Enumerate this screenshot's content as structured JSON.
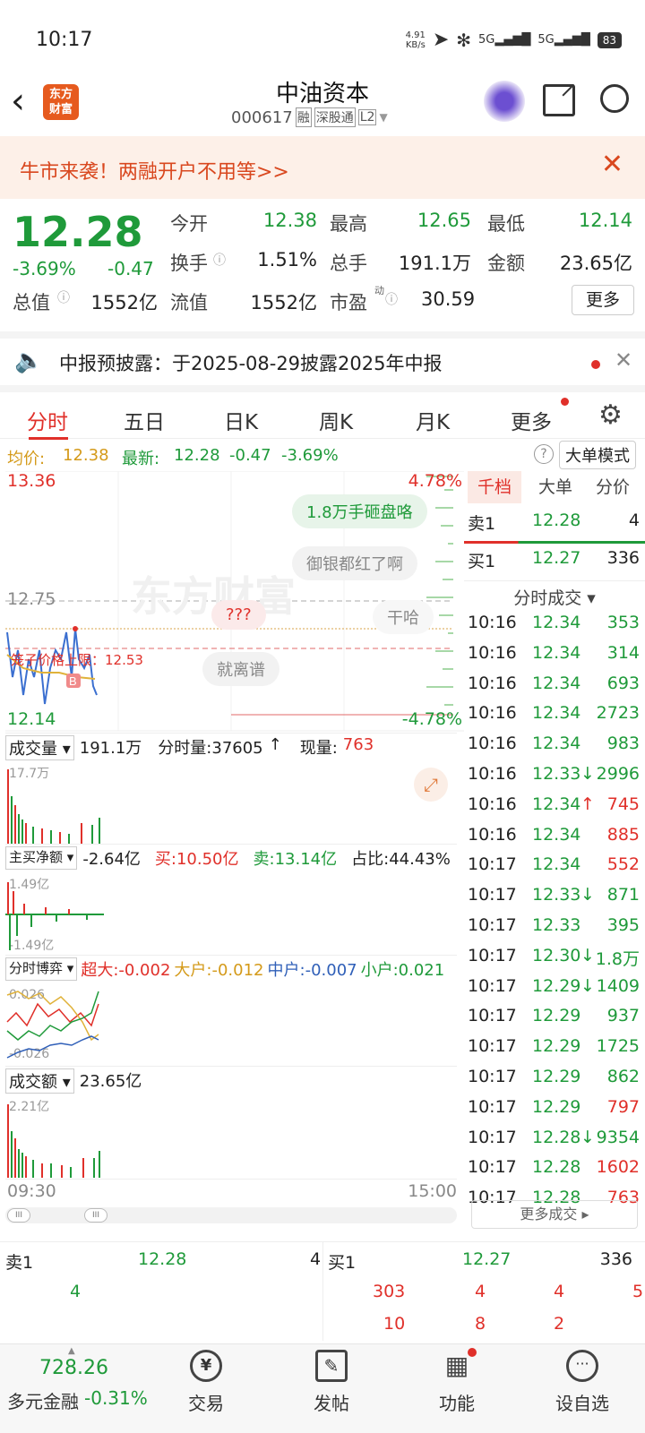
{
  "status": {
    "time": "10:17",
    "net_speed": "4.91\nKB/s",
    "battery": "83"
  },
  "header": {
    "stock_name": "中油资本",
    "code": "000617",
    "tags": [
      "融",
      "深股通",
      "L2"
    ],
    "logo_text": "东方\n财富"
  },
  "promo": {
    "text": "牛市来袭！两融开户不用等>>"
  },
  "quote": {
    "price": "12.28",
    "change_pct": "-3.69%",
    "change": "-0.47",
    "open_label": "今开",
    "open": "12.38",
    "high_label": "最高",
    "high": "12.65",
    "low_label": "最低",
    "low": "12.14",
    "turnover_label": "换手",
    "turnover": "1.51%",
    "volume_label": "总手",
    "volume": "191.1万",
    "amount_label": "金额",
    "amount": "23.65亿",
    "mktcap_label": "总值",
    "mktcap": "1552亿",
    "float_label": "流值",
    "float": "1552亿",
    "pe_label": "市盈",
    "pe_sup": "动",
    "pe": "30.59",
    "more_button": "更多"
  },
  "notice": {
    "text": "中报预披露：于2025-08-29披露2025年中报"
  },
  "tabs": [
    "分时",
    "五日",
    "日K",
    "周K",
    "月K",
    "更多"
  ],
  "avg_line": {
    "avg_label": "均价:",
    "avg": "12.38",
    "last_label": "最新:",
    "last": "12.28",
    "chg": "-0.47",
    "pct": "-3.69%",
    "mode_button": "大单模式"
  },
  "chart": {
    "y_high": "13.36",
    "pct_high": "4.78%",
    "y_low": "12.14",
    "pct_low": "-4.78%",
    "y_ref": "12.75",
    "cage_label": "笼子价格上限：12.53",
    "watermark": "东方财富",
    "bullets": [
      "1.8万手砸盘咯",
      "御银都红了啊",
      "???",
      "干哈",
      "就离谱"
    ],
    "vol_label": "成交量",
    "vol_total": "191.1万",
    "vol_min_label": "分时量:37605",
    "vol_now_label": "现量:",
    "vol_now": "763",
    "vol_max": "17.7万",
    "net_label": "主买净额",
    "net_value": "-2.64亿",
    "net_buy": "买:10.50亿",
    "net_sell": "卖:13.14亿",
    "net_ratio": "占比:44.43%",
    "net_top": "1.49亿",
    "net_bottom": "-1.49亿",
    "game_label": "分时博弈",
    "game_super": "超大:-0.002",
    "game_big": "大户:-0.012",
    "game_mid": "中户:-0.007",
    "game_small": "小户:0.021",
    "game_top": "0.026",
    "game_bottom": "-0.026",
    "amt_label": "成交额",
    "amt_total": "23.65亿",
    "amt_max": "2.21亿",
    "time_start": "09:30",
    "time_end": "15:00"
  },
  "right_panel": {
    "tabs": [
      "千档",
      "大单",
      "分价"
    ],
    "sell1_label": "卖1",
    "sell1_price": "12.28",
    "sell1_vol": "4",
    "buy1_label": "买1",
    "buy1_price": "12.27",
    "buy1_vol": "336",
    "ticks_title": "分时成交",
    "ticks": [
      {
        "t": "10:16",
        "p": "12.34",
        "v": "353",
        "c": "green",
        "a": ""
      },
      {
        "t": "10:16",
        "p": "12.34",
        "v": "314",
        "c": "green",
        "a": ""
      },
      {
        "t": "10:16",
        "p": "12.34",
        "v": "693",
        "c": "green",
        "a": ""
      },
      {
        "t": "10:16",
        "p": "12.34",
        "v": "2723",
        "c": "green",
        "a": ""
      },
      {
        "t": "10:16",
        "p": "12.34",
        "v": "983",
        "c": "green",
        "a": ""
      },
      {
        "t": "10:16",
        "p": "12.33",
        "v": "2996",
        "c": "green",
        "a": "↓"
      },
      {
        "t": "10:16",
        "p": "12.34",
        "v": "745",
        "c": "red",
        "a": "↑"
      },
      {
        "t": "10:16",
        "p": "12.34",
        "v": "885",
        "c": "red",
        "a": ""
      },
      {
        "t": "10:17",
        "p": "12.34",
        "v": "552",
        "c": "red",
        "a": ""
      },
      {
        "t": "10:17",
        "p": "12.33",
        "v": "871",
        "c": "green",
        "a": "↓"
      },
      {
        "t": "10:17",
        "p": "12.33",
        "v": "395",
        "c": "green",
        "a": ""
      },
      {
        "t": "10:17",
        "p": "12.30",
        "v": "1.8万",
        "c": "green",
        "a": "↓"
      },
      {
        "t": "10:17",
        "p": "12.29",
        "v": "1409",
        "c": "green",
        "a": "↓"
      },
      {
        "t": "10:17",
        "p": "12.29",
        "v": "937",
        "c": "green",
        "a": ""
      },
      {
        "t": "10:17",
        "p": "12.29",
        "v": "1725",
        "c": "green",
        "a": ""
      },
      {
        "t": "10:17",
        "p": "12.29",
        "v": "862",
        "c": "green",
        "a": ""
      },
      {
        "t": "10:17",
        "p": "12.29",
        "v": "797",
        "c": "red",
        "a": ""
      },
      {
        "t": "10:17",
        "p": "12.28",
        "v": "9354",
        "c": "green",
        "a": "↓"
      },
      {
        "t": "10:17",
        "p": "12.28",
        "v": "1602",
        "c": "red",
        "a": ""
      },
      {
        "t": "10:17",
        "p": "12.28",
        "v": "763",
        "c": "red",
        "a": ""
      }
    ],
    "more_ticks": "更多成交"
  },
  "order_book": {
    "sell_label": "卖1",
    "sell_price": "12.28",
    "sell_vol": "4",
    "sell_queue": [
      "4"
    ],
    "buy_label": "买1",
    "buy_price": "12.27",
    "buy_vol": "336",
    "buy_queue_row1": [
      "303",
      "4",
      "4",
      "5"
    ],
    "buy_queue_row2": [
      "10",
      "8",
      "2"
    ]
  },
  "bottom_nav": {
    "index_value": "728.26",
    "index_name": "多元金融",
    "index_pct": "-0.31%",
    "items": [
      "交易",
      "发帖",
      "功能",
      "设自选"
    ]
  }
}
